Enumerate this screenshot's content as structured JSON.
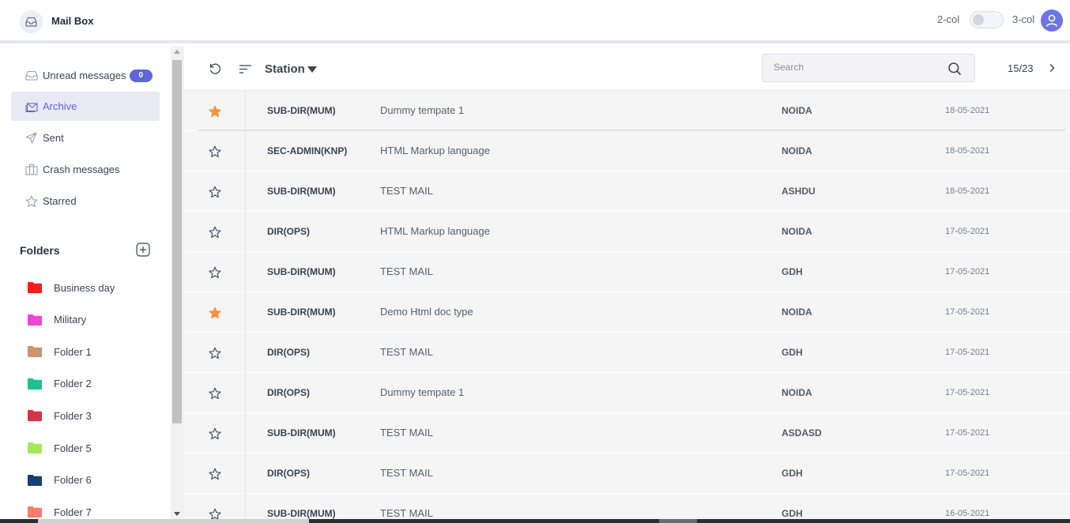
{
  "app": {
    "title": "Mail Box",
    "layout_left_label": "2-col",
    "layout_right_label": "3-col",
    "accent": "#5f66d6"
  },
  "sidebar": {
    "nav": [
      {
        "label": "Unread messages",
        "icon": "inbox-icon",
        "badge": "0",
        "active": false
      },
      {
        "label": "Archive",
        "icon": "archive-mail-icon",
        "active": true
      },
      {
        "label": "Sent",
        "icon": "send-icon",
        "active": false
      },
      {
        "label": "Crash messages",
        "icon": "briefcase-icon",
        "active": false
      },
      {
        "label": "Starred",
        "icon": "star-icon",
        "active": false
      }
    ],
    "folders_title": "Folders",
    "folders": [
      {
        "label": "Business day",
        "color": "#f41d1d"
      },
      {
        "label": "Military",
        "color": "#f046d6"
      },
      {
        "label": "Folder 1",
        "color": "#c9946f"
      },
      {
        "label": "Folder 2",
        "color": "#1fbf8f"
      },
      {
        "label": "Folder 3",
        "color": "#d2354a"
      },
      {
        "label": "Folder 5",
        "color": "#a6e85c"
      },
      {
        "label": "Folder 6",
        "color": "#143f72"
      },
      {
        "label": "Folder 7",
        "color": "#f57d6c"
      }
    ]
  },
  "toolbar": {
    "station_label": "Station",
    "search_placeholder": "Search",
    "pager": "15/23"
  },
  "messages": [
    {
      "starred": true,
      "from": "SUB-DIR(MUM)",
      "subject": "Dummy tempate 1",
      "station": "NOIDA",
      "date": "18-05-2021"
    },
    {
      "starred": false,
      "from": "SEC-ADMIN(KNP)",
      "subject": "HTML Markup language",
      "station": "NOIDA",
      "date": "18-05-2021"
    },
    {
      "starred": false,
      "from": "SUB-DIR(MUM)",
      "subject": "TEST MAIL",
      "station": "ASHDU",
      "date": "18-05-2021"
    },
    {
      "starred": false,
      "from": "DIR(OPS)",
      "subject": "HTML Markup language",
      "station": "NOIDA",
      "date": "17-05-2021"
    },
    {
      "starred": false,
      "from": "SUB-DIR(MUM)",
      "subject": "TEST MAIL",
      "station": "GDH",
      "date": "17-05-2021"
    },
    {
      "starred": true,
      "from": "SUB-DIR(MUM)",
      "subject": "Demo Html doc type",
      "station": "NOIDA",
      "date": "17-05-2021"
    },
    {
      "starred": false,
      "from": "DIR(OPS)",
      "subject": "TEST MAIL",
      "station": "GDH",
      "date": "17-05-2021"
    },
    {
      "starred": false,
      "from": "DIR(OPS)",
      "subject": "Dummy tempate 1",
      "station": "NOIDA",
      "date": "17-05-2021"
    },
    {
      "starred": false,
      "from": "SUB-DIR(MUM)",
      "subject": "TEST MAIL",
      "station": "ASDASD",
      "date": "17-05-2021"
    },
    {
      "starred": false,
      "from": "DIR(OPS)",
      "subject": "TEST MAIL",
      "station": "GDH",
      "date": "17-05-2021"
    },
    {
      "starred": false,
      "from": "SUB-DIR(MUM)",
      "subject": "TEST MAIL",
      "station": "GDH",
      "date": "16-05-2021"
    }
  ],
  "colors": {
    "star_filled": "#f5923e",
    "star_outline": "#4a4f5c",
    "row_bg": "#f4f5f4"
  }
}
